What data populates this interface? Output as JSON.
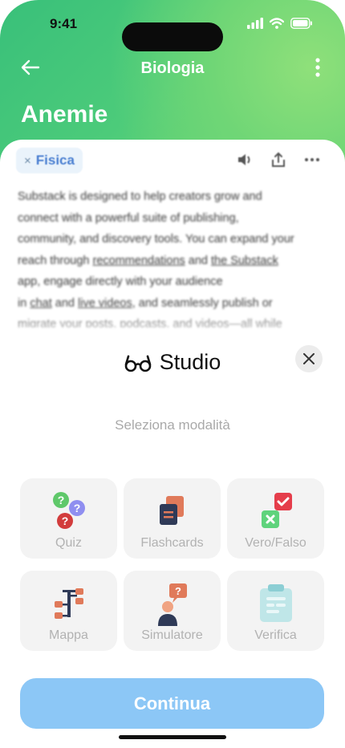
{
  "status_bar": {
    "time": "9:41"
  },
  "nav": {
    "title": "Biologia"
  },
  "page": {
    "title": "Anemie"
  },
  "document": {
    "chip_close": "×",
    "chip_label": "Fisica",
    "line1": "Substack is designed to help creators grow and",
    "line2": "connect with a powerful suite of publishing,",
    "line3": "community, and discovery tools. You can expand your",
    "line4a": "reach through ",
    "line4b": "recommendations",
    "line4c": " and ",
    "line4d": "the Substack",
    "line5": "app, engage directly with your audience",
    "line6a": "in ",
    "line6b": "chat",
    "line6c": " and ",
    "line6d": "live videos",
    "line6e": ", and seamlessly publish or",
    "line7": "migrate your posts, podcasts, and videos—all while"
  },
  "studio": {
    "title": "Studio",
    "subtitle": "Seleziona modalità",
    "modes": [
      {
        "label": "Quiz",
        "icon": "quiz-icon"
      },
      {
        "label": "Flashcards",
        "icon": "flashcards-icon"
      },
      {
        "label": "Vero/Falso",
        "icon": "true-false-icon"
      },
      {
        "label": "Mappa",
        "icon": "mind-map-icon"
      },
      {
        "label": "Simulatore",
        "icon": "simulator-icon"
      },
      {
        "label": "Verifica",
        "icon": "clipboard-icon"
      }
    ],
    "cta_label": "Continua"
  },
  "colors": {
    "header_green": "#4ccb7a",
    "chip_blue": "#4a7fd1",
    "cta_blue": "#8cc7f6",
    "card_bg": "#f3f3f3"
  }
}
